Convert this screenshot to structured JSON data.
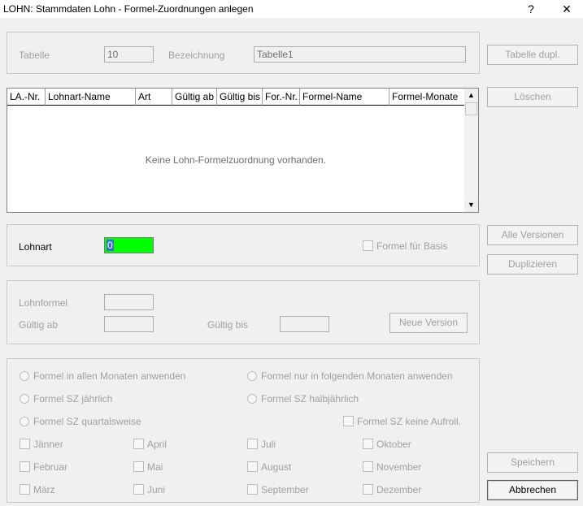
{
  "window": {
    "title": "LOHN: Stammdaten Lohn - Formel-Zuordnungen anlegen",
    "help_glyph": "?",
    "close_glyph": "✕"
  },
  "table_section": {
    "tabelle_label": "Tabelle",
    "tabelle_value": "10",
    "bezeichnung_label": "Bezeichnung",
    "bezeichnung_value": "Tabelle1"
  },
  "grid": {
    "columns": [
      "LA.-Nr.",
      "Lohnart-Name",
      "Art",
      "Gültig ab",
      "Gültig bis",
      "For.-Nr.",
      "Formel-Name",
      "Formel-Monate"
    ],
    "empty_message": "Keine Lohn-Formelzuordnung vorhanden.",
    "scroll_up": "▲",
    "scroll_down": "▼"
  },
  "lohnart_section": {
    "label": "Lohnart",
    "value": "0",
    "formel_basis_label": "Formel für Basis"
  },
  "lohnformel_section": {
    "lohnformel_label": "Lohnformel",
    "lohnformel_value": "",
    "gueltig_ab_label": "Gültig ab",
    "gueltig_ab_value": "",
    "gueltig_bis_label": "Gültig bis",
    "gueltig_bis_value": "",
    "neue_version_label": "Neue Version"
  },
  "months_section": {
    "radio_all_months": "Formel in allen Monaten anwenden",
    "radio_following_months": "Formel nur in folgenden Monaten anwenden",
    "radio_sz_yearly": "Formel SZ jährlich",
    "radio_sz_halfyearly": "Formel SZ halbjährlich",
    "radio_sz_quarterly": "Formel SZ quartalsweise",
    "chk_sz_no_aufroll": "Formel SZ keine Aufroll.",
    "months": [
      "Jänner",
      "April",
      "Juli",
      "Oktober",
      "Februar",
      "Mai",
      "August",
      "November",
      "März",
      "Juni",
      "September",
      "Dezember"
    ]
  },
  "side_buttons": {
    "tabelle_dupl": "Tabelle dupl.",
    "loeschen": "Löschen",
    "alle_versionen": "Alle Versionen",
    "duplizieren": "Duplizieren",
    "speichern": "Speichern",
    "abbrechen": "Abbrechen"
  }
}
